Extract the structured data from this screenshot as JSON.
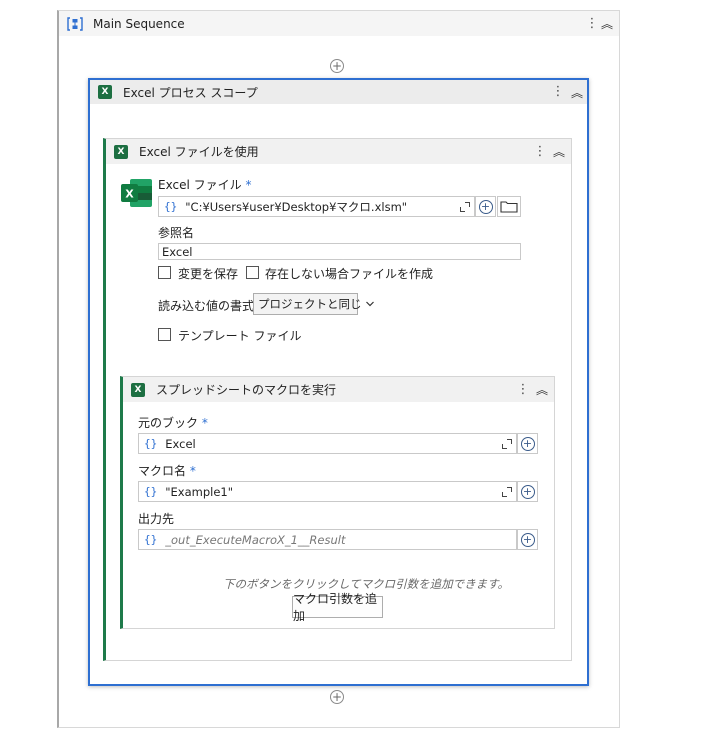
{
  "main_sequence": {
    "title": "Main Sequence"
  },
  "scope": {
    "title": "Excel プロセス スコープ"
  },
  "use_file": {
    "title": "Excel ファイルを使用",
    "file_label": "Excel ファイル",
    "required_mark": "*",
    "file_value": "\"C:¥Users¥user¥Desktop¥マクロ.xlsm\"",
    "ref_label": "参照名",
    "ref_value": "Excel",
    "save_changes_label": "変更を保存",
    "create_if_missing_label": "存在しない場合ファイルを作成",
    "read_format_label": "読み込む値の書式",
    "read_format_value": "プロジェクトと同じ",
    "template_label": "テンプレート ファイル"
  },
  "run_macro": {
    "title": "スプレッドシートのマクロを実行",
    "book_label": "元のブック",
    "book_value": "Excel",
    "macro_label": "マクロ名",
    "macro_value": "\"Example1\"",
    "output_label": "出力先",
    "output_value": "_out_ExecuteMacroX_1__Result",
    "hint": "下のボタンをクリックしてマクロ引数を追加できます。",
    "add_args_button": "マクロ引数を追加"
  },
  "glyphs": {
    "brace": "{}",
    "dots": "⋮",
    "chevron_up": "︽",
    "plus": "+",
    "excel": "X"
  },
  "colors": {
    "accent": "#2e6fd1",
    "excel_green": "#1d6f42",
    "activity_border": "#1e7a4a"
  }
}
